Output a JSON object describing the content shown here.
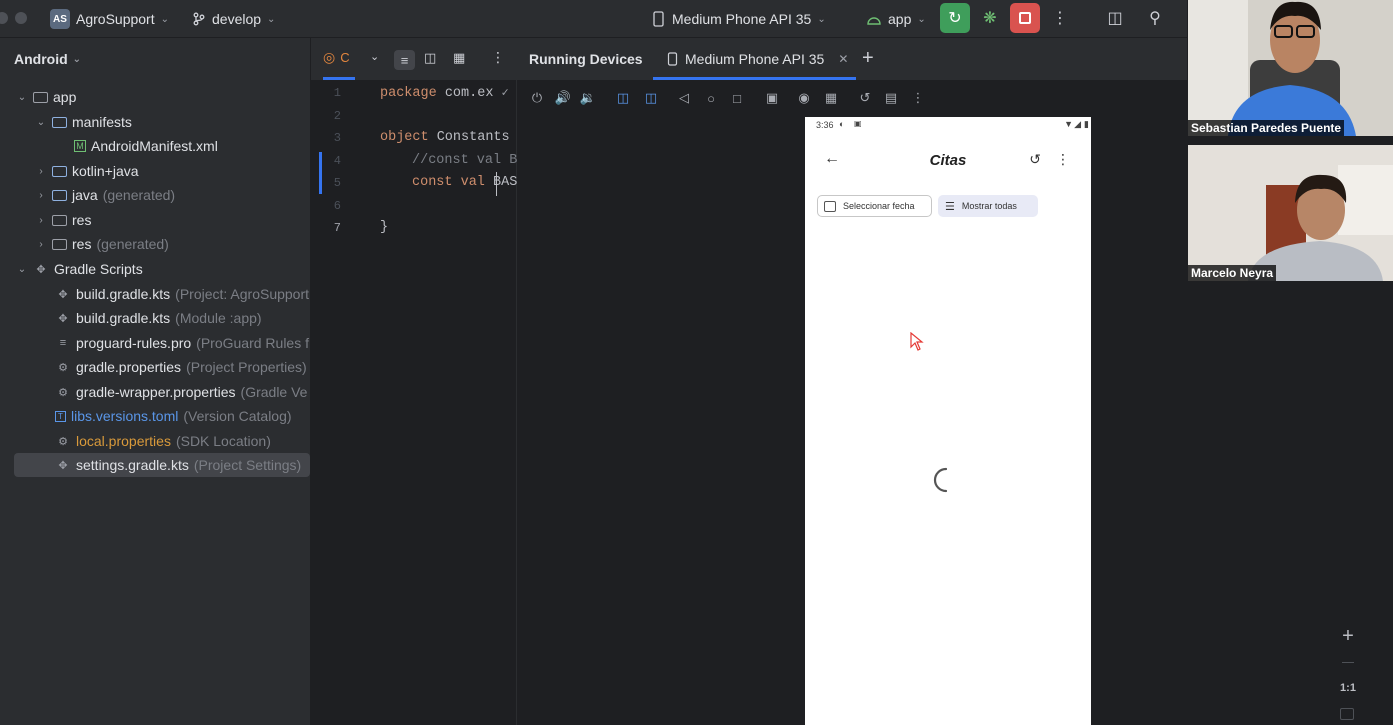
{
  "titlebar": {
    "project_badge": "AS",
    "project_name": "AgroSupport",
    "branch_icon": "branch-icon",
    "branch": "develop",
    "device": "Medium Phone API 35",
    "run_config": "app"
  },
  "project_panel": {
    "view_mode": "Android",
    "tree": [
      {
        "label": "app",
        "hint": ""
      },
      {
        "label": "manifests",
        "hint": ""
      },
      {
        "label": "AndroidManifest.xml",
        "hint": ""
      },
      {
        "label": "kotlin+java",
        "hint": ""
      },
      {
        "label": "java",
        "hint": "(generated)"
      },
      {
        "label": "res",
        "hint": ""
      },
      {
        "label": "res",
        "hint": "(generated)"
      },
      {
        "label": "Gradle Scripts",
        "hint": ""
      },
      {
        "label": "build.gradle.kts",
        "hint": "(Project: AgroSupport"
      },
      {
        "label": "build.gradle.kts",
        "hint": "(Module :app)"
      },
      {
        "label": "proguard-rules.pro",
        "hint": "(ProGuard Rules f"
      },
      {
        "label": "gradle.properties",
        "hint": "(Project Properties)"
      },
      {
        "label": "gradle-wrapper.properties",
        "hint": "(Gradle Ve"
      },
      {
        "label": "libs.versions.toml",
        "hint": "(Version Catalog)"
      },
      {
        "label": "local.properties",
        "hint": "(SDK Location)"
      },
      {
        "label": "settings.gradle.kts",
        "hint": "(Project Settings)"
      }
    ]
  },
  "editor": {
    "tab_label": "C",
    "line_numbers": [
      "1",
      "2",
      "3",
      "4",
      "5",
      "6",
      "7"
    ],
    "code": {
      "l1_kw": "package",
      "l1_rest": " com.ex",
      "l3_kw": "object",
      "l3_rest": " Constants",
      "l4": "//const val B",
      "l5_kw": "const val",
      "l5_rest": " BAS",
      "l7": "}"
    }
  },
  "running_devices": {
    "title": "Running Devices",
    "tab_label": "Medium Phone API 35",
    "add_label": "+",
    "zoom_label": "1:1"
  },
  "phone": {
    "status_time": "3:36",
    "screen_title": "Citas",
    "btn_select_date": "Seleccionar fecha",
    "btn_show_all": "Mostrar todas"
  },
  "participants": [
    {
      "name": "Sebastian Paredes Puente"
    },
    {
      "name": "Marcelo Neyra"
    }
  ]
}
